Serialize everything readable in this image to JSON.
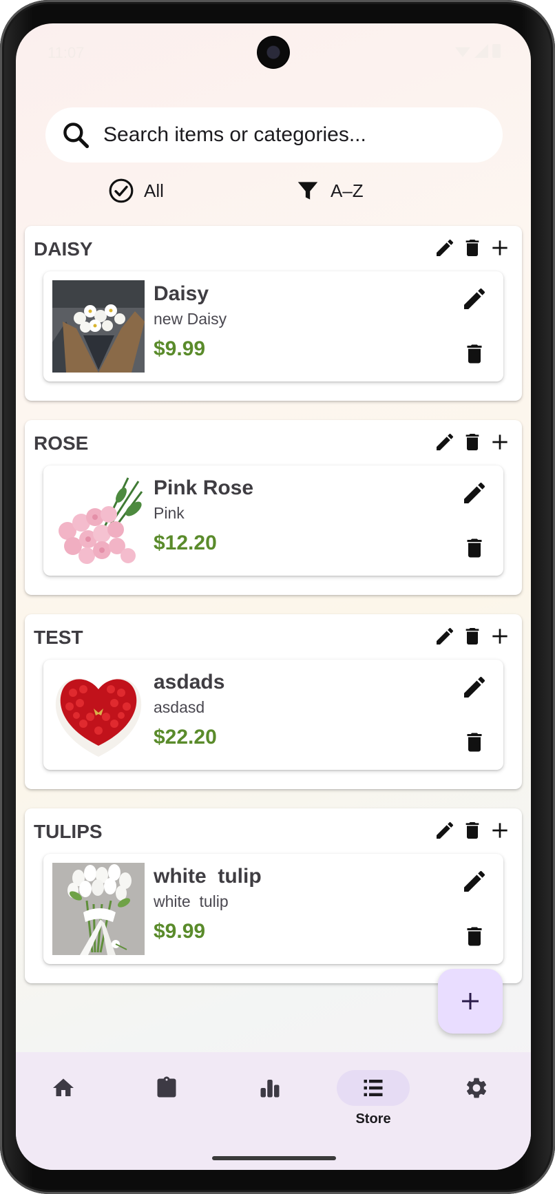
{
  "status_bar": {
    "time": "11:07"
  },
  "search": {
    "placeholder": "Search items or categories..."
  },
  "filters": {
    "selection_label": "All",
    "sort_label": "A–Z"
  },
  "categories": [
    {
      "title": "DAISY",
      "items": [
        {
          "name": "Daisy",
          "description": "new Daisy",
          "price": "$9.99",
          "image": "daisy-bouquet"
        }
      ]
    },
    {
      "title": "ROSE",
      "items": [
        {
          "name": "Pink Rose",
          "description": "Pink",
          "price": "$12.20",
          "image": "pink-roses"
        }
      ]
    },
    {
      "title": "TEST",
      "items": [
        {
          "name": "asdads",
          "description": "asdasd",
          "price": "$22.20",
          "image": "heart-rose-box"
        }
      ]
    },
    {
      "title": "TULIPS",
      "items": [
        {
          "name": "white  tulip",
          "description": "white  tulip",
          "price": "$9.99",
          "image": "white-tulips"
        }
      ]
    }
  ],
  "fab": {
    "icon": "plus-icon"
  },
  "bottom_nav": {
    "items": [
      {
        "icon": "home-icon",
        "label": ""
      },
      {
        "icon": "clipboard-icon",
        "label": ""
      },
      {
        "icon": "bar-chart-icon",
        "label": ""
      },
      {
        "icon": "list-icon",
        "label": "Store",
        "active": true
      },
      {
        "icon": "gear-icon",
        "label": ""
      }
    ]
  },
  "colors": {
    "price": "#5a8b2b",
    "fab_background": "#e9ddff",
    "nav_background": "#f1e9f5",
    "nav_active_pill": "#e6dcf4"
  }
}
